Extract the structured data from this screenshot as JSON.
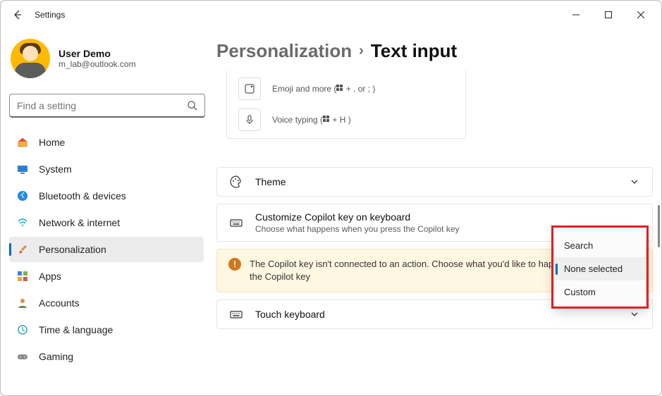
{
  "window": {
    "title": "Settings"
  },
  "user": {
    "name": "User Demo",
    "email": "m_lab@outlook.com"
  },
  "search": {
    "placeholder": "Find a setting"
  },
  "nav": {
    "items": [
      {
        "label": "Home"
      },
      {
        "label": "System"
      },
      {
        "label": "Bluetooth & devices"
      },
      {
        "label": "Network & internet"
      },
      {
        "label": "Personalization"
      },
      {
        "label": "Apps"
      },
      {
        "label": "Accounts"
      },
      {
        "label": "Time & language"
      },
      {
        "label": "Gaming"
      }
    ],
    "active_index": 4
  },
  "breadcrumb": {
    "parent": "Personalization",
    "current": "Text input"
  },
  "topcard": {
    "emoji_label": "Emoji and more (",
    "emoji_keys": " + . or ; )",
    "voice_label": "Voice typing (",
    "voice_keys": " + H )"
  },
  "rows": {
    "theme": {
      "title": "Theme"
    },
    "copilot": {
      "title": "Customize Copilot key on keyboard",
      "subtitle": "Choose what happens when you press the Copilot key"
    },
    "touch": {
      "title": "Touch keyboard"
    }
  },
  "warning": {
    "text": "The Copilot key isn't connected to an action. Choose what you'd like to happen when you press the Copilot key"
  },
  "dropdown": {
    "options": [
      {
        "label": "Search"
      },
      {
        "label": "None selected"
      },
      {
        "label": "Custom"
      }
    ],
    "selected_index": 1
  }
}
